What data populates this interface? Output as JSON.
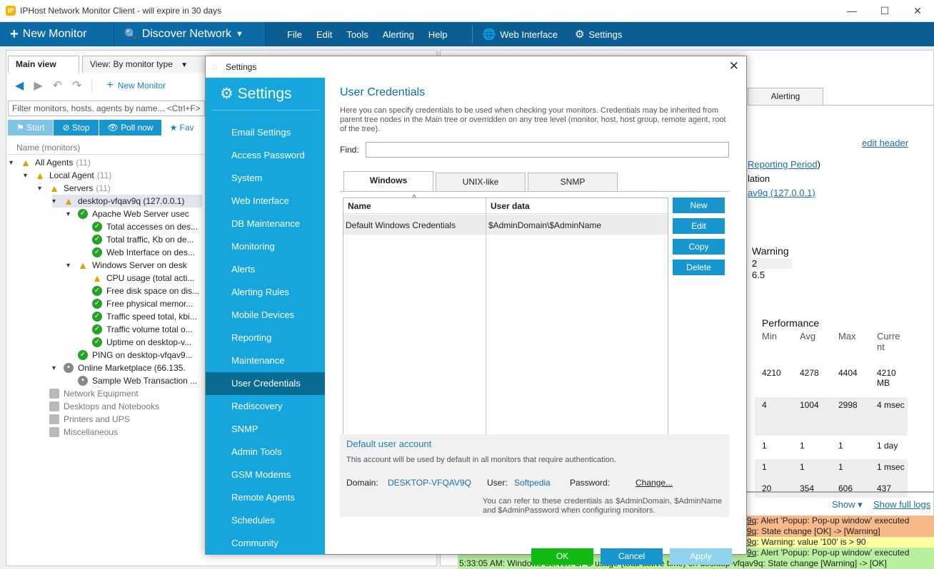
{
  "window": {
    "app_icon": "IP",
    "title": "IPHost Network Monitor Client - will expire in 30 days",
    "minimize": "—",
    "maximize": "☐",
    "close": "✕"
  },
  "toolbar": {
    "new_monitor": "New Monitor",
    "discover": "Discover Network",
    "menu": [
      "File",
      "Edit",
      "Tools",
      "Alerting",
      "Help"
    ],
    "web_interface": "Web Interface",
    "settings": "Settings"
  },
  "left": {
    "tab_main": "Main view",
    "tab_view": "View: By monitor type",
    "new_monitor": "New Monitor",
    "filter": "Filter monitors, hosts, agents by name... <Ctrl+F>",
    "start": "Start",
    "stop": "Stop",
    "poll": "Poll now",
    "fav": "Fav",
    "col": "Name (monitors)",
    "tree": [
      {
        "t": "All Agents",
        "c": "(11)",
        "lvl": 0,
        "icon": "warn",
        "ex": "▾"
      },
      {
        "t": "Local Agent",
        "c": "(11)",
        "lvl": 1,
        "icon": "warn",
        "ex": "▾"
      },
      {
        "t": "Servers",
        "c": "(11)",
        "lvl": 2,
        "icon": "warn",
        "ex": "▾"
      },
      {
        "t": "desktop-vfqav9q (127.0.0.1)",
        "c": "",
        "lvl": 3,
        "icon": "warn",
        "ex": "▾"
      },
      {
        "t": "Apache Web Server usec",
        "c": "",
        "lvl": 4,
        "icon": "ok",
        "ex": "▾"
      },
      {
        "t": "Total accesses on des...",
        "c": "",
        "lvl": 5,
        "icon": "ok",
        "ex": ""
      },
      {
        "t": "Total traffic, Kb on de...",
        "c": "",
        "lvl": 5,
        "icon": "ok",
        "ex": ""
      },
      {
        "t": "Web Interface on des...",
        "c": "",
        "lvl": 5,
        "icon": "ok",
        "ex": ""
      },
      {
        "t": "Windows Server on desk",
        "c": "",
        "lvl": 4,
        "icon": "warn",
        "ex": "▾"
      },
      {
        "t": "CPU usage (total acti...",
        "c": "",
        "lvl": 5,
        "icon": "warn",
        "ex": ""
      },
      {
        "t": "Free disk space on dis...",
        "c": "",
        "lvl": 5,
        "icon": "ok",
        "ex": ""
      },
      {
        "t": "Free physical memor...",
        "c": "",
        "lvl": 5,
        "icon": "ok",
        "ex": ""
      },
      {
        "t": "Traffic speed total, kbi...",
        "c": "",
        "lvl": 5,
        "icon": "ok",
        "ex": ""
      },
      {
        "t": "Traffic volume total o...",
        "c": "",
        "lvl": 5,
        "icon": "ok",
        "ex": ""
      },
      {
        "t": "Uptime on desktop-v...",
        "c": "",
        "lvl": 5,
        "icon": "ok",
        "ex": ""
      },
      {
        "t": "PING on desktop-vfqav9...",
        "c": "",
        "lvl": 4,
        "icon": "ok",
        "ex": ""
      },
      {
        "t": "Online Marketplace (66.135.",
        "c": "",
        "lvl": 3,
        "icon": "gray",
        "ex": "▾"
      },
      {
        "t": "Sample Web Transaction ...",
        "c": "",
        "lvl": 4,
        "icon": "gray",
        "ex": ""
      },
      {
        "t": "Network Equipment",
        "c": "",
        "lvl": 2,
        "icon": "fold",
        "ex": ""
      },
      {
        "t": "Desktops and Notebooks",
        "c": "",
        "lvl": 2,
        "icon": "fold",
        "ex": ""
      },
      {
        "t": "Printers and UPS",
        "c": "",
        "lvl": 2,
        "icon": "fold",
        "ex": ""
      },
      {
        "t": "Miscellaneous",
        "c": "",
        "lvl": 2,
        "icon": "fold",
        "ex": ""
      }
    ]
  },
  "right": {
    "alert_tab": "Alerting",
    "edit_header": "edit header",
    "rp": "Reporting Period",
    "rp_paren": ")",
    "lation": "lation",
    "host": "av9q (127.0.0.1)",
    "warning": "Warning",
    "w1": "2",
    "w2": "6.5",
    "perf": "Performance",
    "min": "Min",
    "avg": "Avg",
    "max": "Max",
    "curr": "Curre nt",
    "rows": [
      [
        "4210",
        "4278",
        "4404",
        "4210 MB"
      ],
      [
        "4",
        "1004",
        "2998",
        "4 msec"
      ],
      [
        "1",
        "1",
        "1",
        "1 day"
      ],
      [
        "1",
        "1",
        "1",
        "1 msec"
      ],
      [
        "20",
        "354",
        "606",
        "437"
      ]
    ],
    "show": "Show",
    "full_logs": "Show full logs",
    "logs": [
      {
        "a": "9q",
        "b": ": Alert 'Popup: Pop-up window' executed"
      },
      {
        "a": "9q",
        "b": ": State change [OK] -> [Warning]"
      },
      {
        "a": "9q",
        "b": ": Warning: value '100' is > 90"
      },
      {
        "a": "9q",
        "b": ": Alert 'Popup: Pop-up window' executed"
      },
      {
        "a": "",
        "b": "5:33:05 AM: Windows Server: CPU usage (total active time) on desktop-vfqav9q: State change [Warning] -> [OK]"
      }
    ]
  },
  "dialog": {
    "title": "Settings",
    "close": "✕",
    "side_head": "Settings",
    "side": [
      "Email Settings",
      "Access Password",
      "System",
      "Web Interface",
      "DB Maintenance",
      "Monitoring",
      "Alerts",
      "Alerting Rules",
      "Mobile Devices",
      "Reporting",
      "Maintenance",
      "User Credentials",
      "Rediscovery",
      "SNMP",
      "Admin Tools",
      "GSM Modems",
      "Remote Agents",
      "Schedules",
      "Community"
    ],
    "heading": "User Credentials",
    "desc": "Here you can specify credentials to be used when checking your monitors. Credentials may be inherited from parent tree nodes in the Main tree or overridden on any tree level (monitor, host, host group, remote agent, root of the tree).",
    "find": "Find:",
    "tabs": [
      "Windows",
      "UNIX-like",
      "SNMP"
    ],
    "col_name": "Name",
    "col_user": "User data",
    "row_name": "Default Windows Credentials",
    "row_user": "$AdminDomain\\$AdminName",
    "btn_new": "New",
    "btn_edit": "Edit",
    "btn_copy": "Copy",
    "btn_delete": "Delete",
    "def_head": "Default user account",
    "def_text": "This account will be used by default in all monitors that require authentication.",
    "domain_l": "Domain:",
    "domain_v": "DESKTOP-VFQAV9Q",
    "user_l": "User:",
    "user_v": "Softpedia",
    "pass_l": "Password:",
    "change": "Change...",
    "note": "You can refer to these credentials as $AdminDomain, $AdminName and $AdminPassword when configuring monitors.",
    "ok": "OK",
    "cancel": "Cancel",
    "apply": "Apply"
  },
  "colors": {
    "toolbar": "#0a5e94",
    "sidebar": "#14a6dc",
    "accent": "#1896d0",
    "ok_btn": "#12bb12"
  }
}
